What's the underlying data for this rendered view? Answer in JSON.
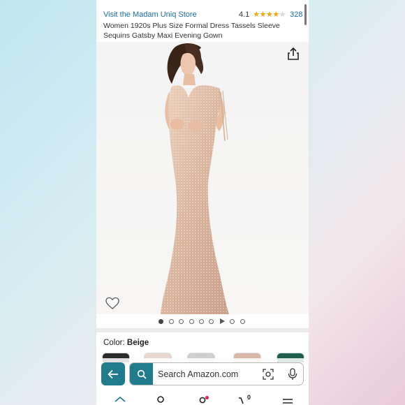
{
  "header": {
    "store_link": "Visit the Madam Uniq Store",
    "rating": 4.1,
    "rating_text": "4.1",
    "stars_glyphs": "★★★★★",
    "review_count": "328",
    "title": "Women 1920s Plus Size Formal Dress Tassels Sleeve Sequins Gatsby Maxi Evening Gown"
  },
  "gallery": {
    "image_count": 9,
    "active_index": 0,
    "video_index": 6,
    "share_icon": "share-icon",
    "wishlist_icon": "heart-icon"
  },
  "variation": {
    "color_label": "Color:",
    "color_value": "Beige"
  },
  "search": {
    "placeholder": "Search Amazon.com",
    "back_icon": "back-arrow-icon",
    "search_icon": "search-icon",
    "camera_icon": "camera-scan-icon",
    "mic_icon": "microphone-icon"
  },
  "bottom_nav": {
    "items": [
      "home-icon",
      "profile-icon",
      "account-icon",
      "cart-icon",
      "menu-icon"
    ],
    "cart_count": "0"
  },
  "colors": {
    "link": "#1a6ea3",
    "star": "#f2a60c",
    "accent": "#1f7c8c",
    "notification": "#d6245c"
  }
}
